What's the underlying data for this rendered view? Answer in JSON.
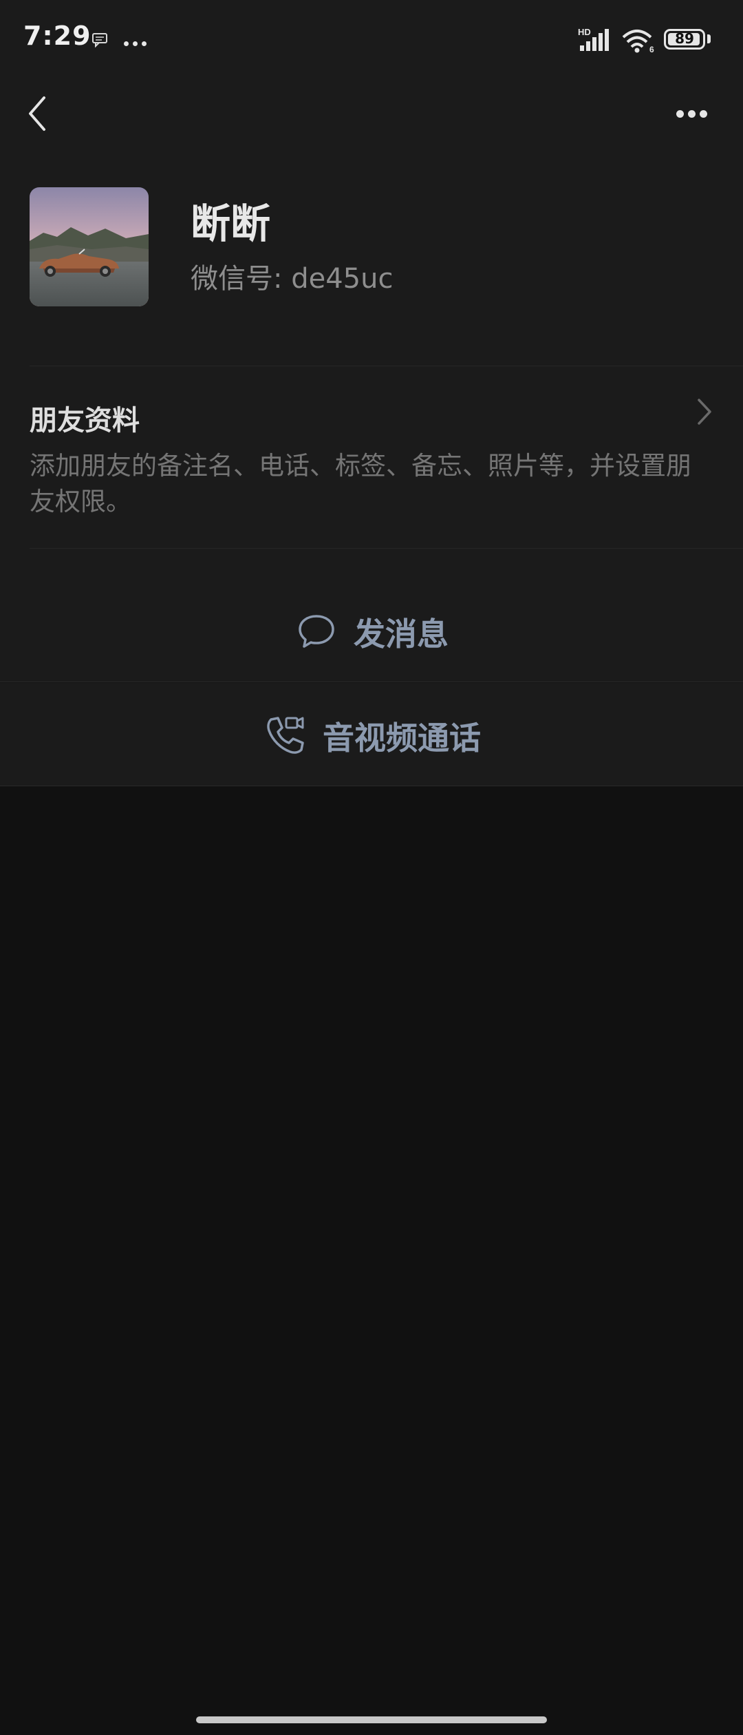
{
  "status_bar": {
    "time": "7:29",
    "battery": "89",
    "network_label": "HD",
    "wifi_label": "6",
    "icons": [
      "message-icon",
      "more-dots-icon",
      "signal-icon",
      "wifi-icon",
      "battery-icon"
    ]
  },
  "navigation": {
    "back_icon": "chevron-left-icon",
    "more_icon": "more-horizontal-icon"
  },
  "profile": {
    "name": "断断",
    "wechat_id": "微信号: de45uc",
    "avatar": "vintage convertible car at sunset"
  },
  "friend_info": {
    "title": "朋友资料",
    "description": "添加朋友的备注名、电话、标签、备忘、照片等，并设置朋友权限。"
  },
  "actions": {
    "send_message": "发消息",
    "av_call": "音视频通话"
  },
  "colors": {
    "background": "#111111",
    "panel": "#1b1b1b",
    "action_text": "#8c9aaf",
    "secondary_text": "#757575"
  }
}
